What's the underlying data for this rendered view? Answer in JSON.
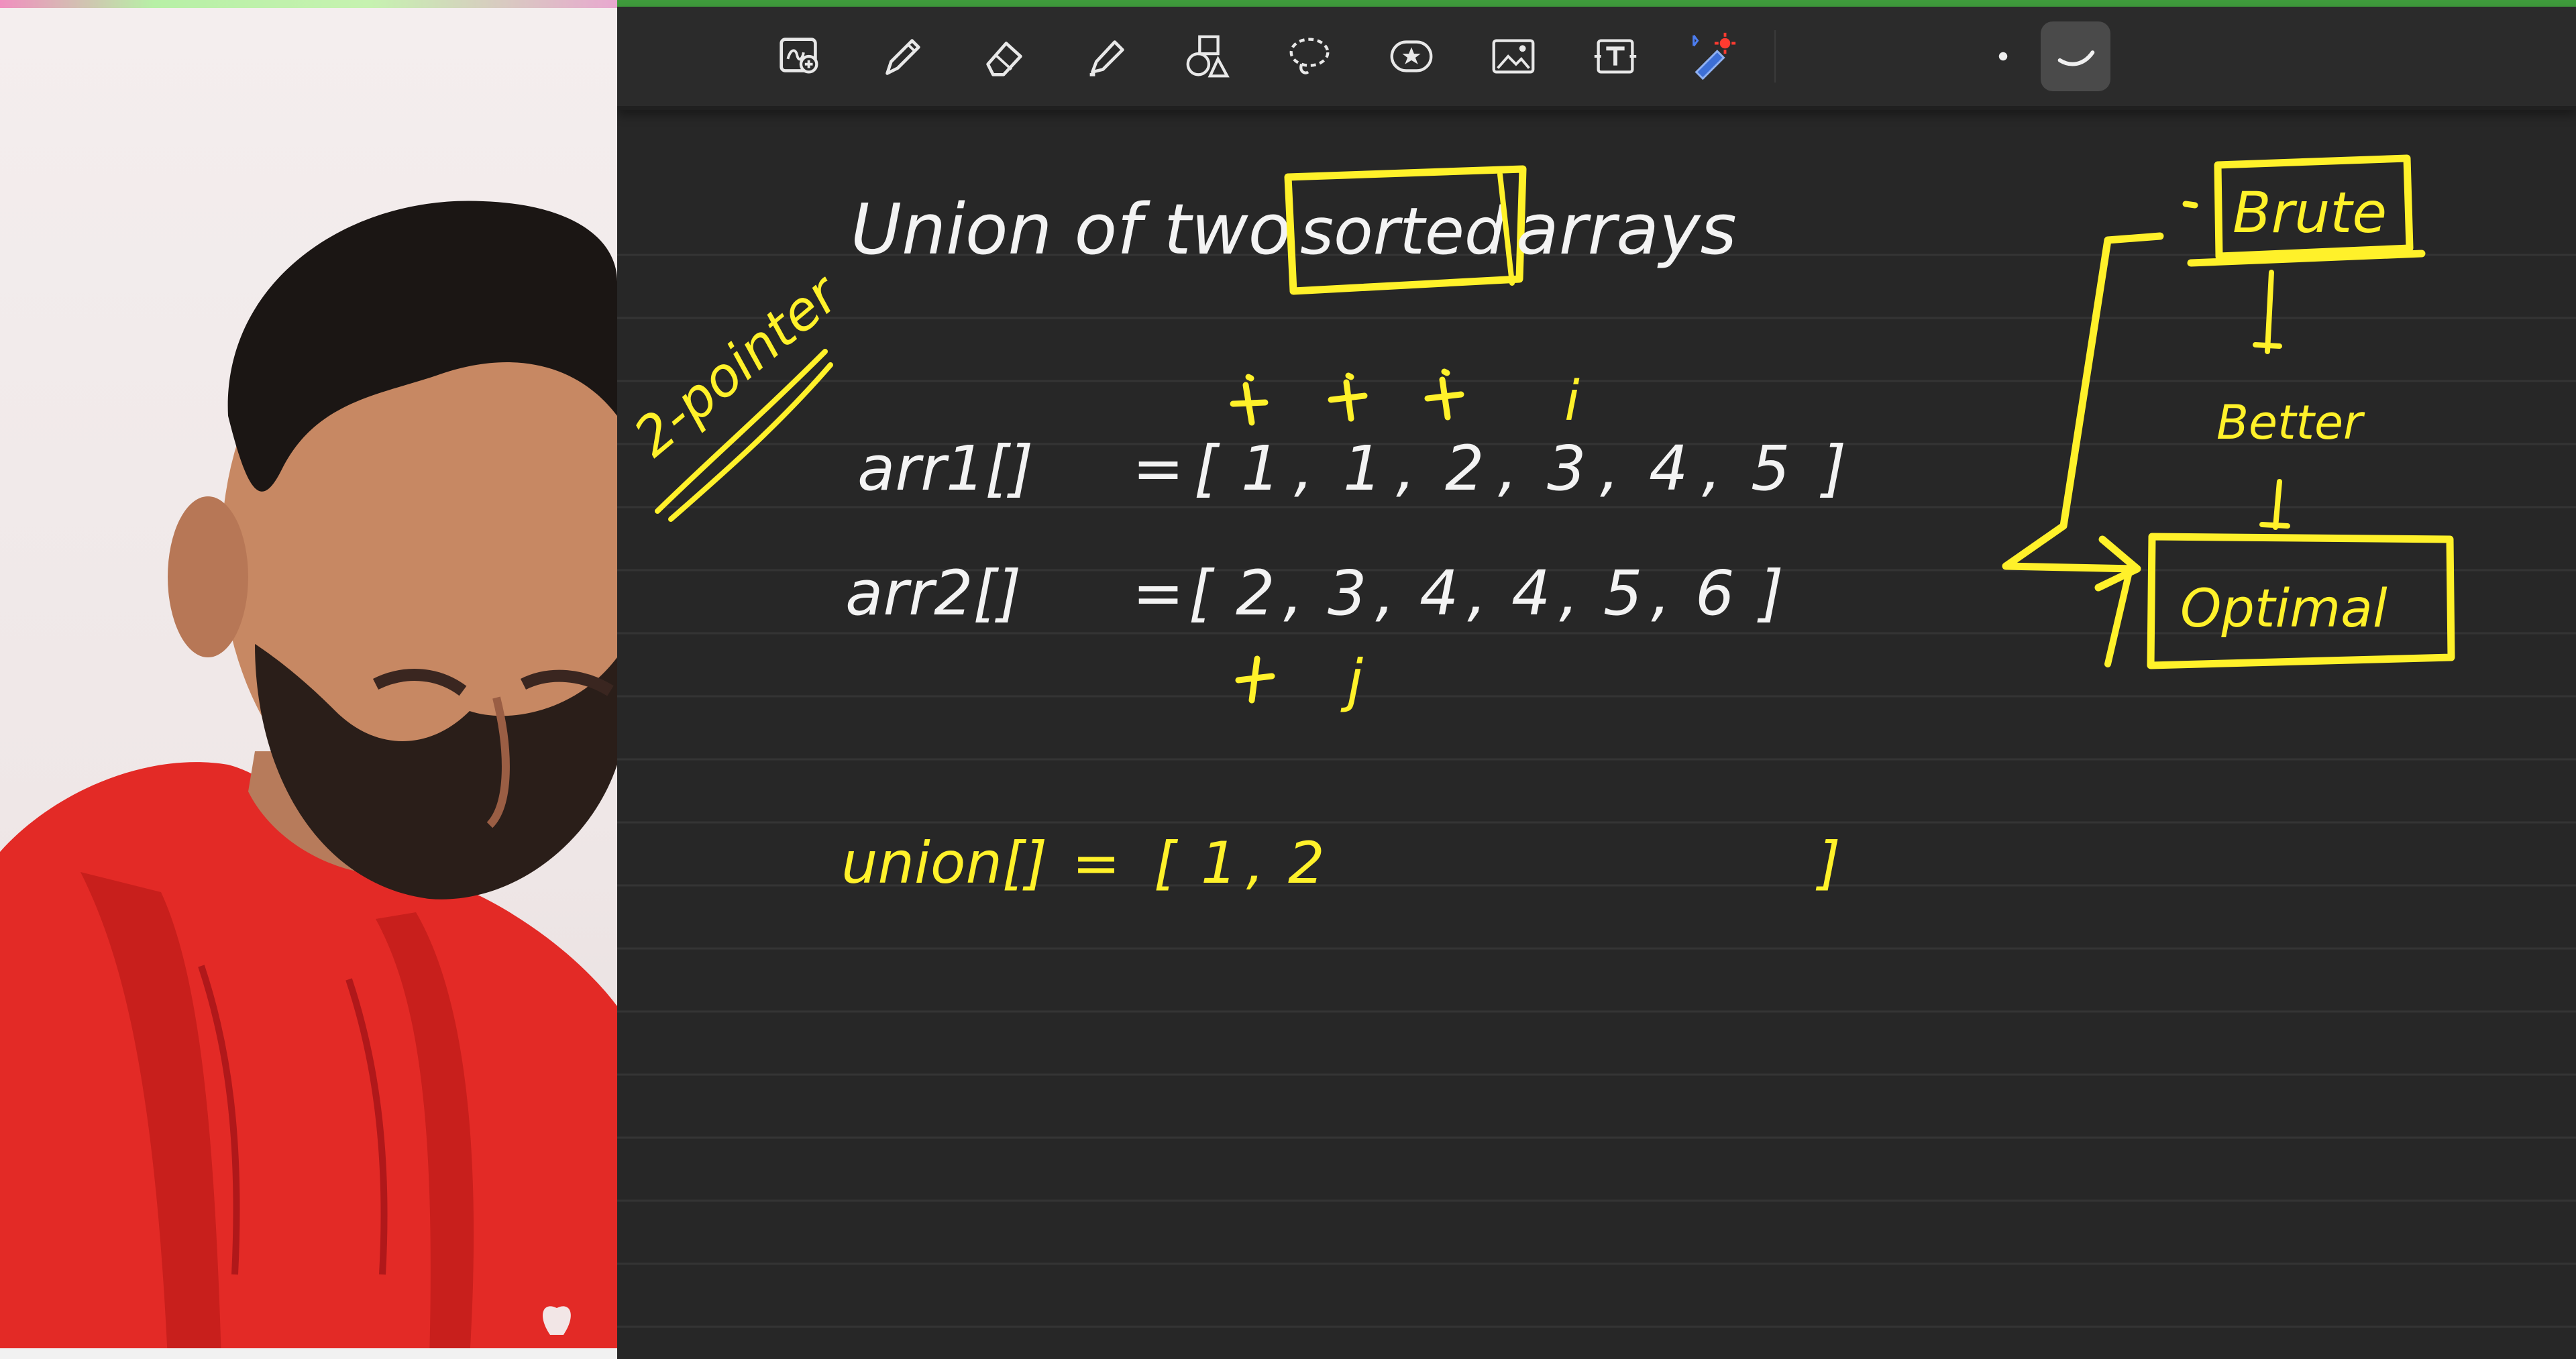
{
  "toolbar": {
    "tools": [
      {
        "name": "zoom-box-tool-icon",
        "active": false
      },
      {
        "name": "pen-tool-icon",
        "active": false
      },
      {
        "name": "eraser-tool-icon",
        "active": false
      },
      {
        "name": "highlighter-tool-icon",
        "active": false
      },
      {
        "name": "shapes-tool-icon",
        "active": false
      },
      {
        "name": "lasso-tool-icon",
        "active": false
      },
      {
        "name": "sticker-tool-icon",
        "active": false
      },
      {
        "name": "image-tool-icon",
        "active": false
      },
      {
        "name": "text-tool-icon",
        "active": false
      },
      {
        "name": "laser-pointer-tool-icon",
        "active": false
      },
      {
        "name": "stroke-size-dot-icon",
        "active": false
      },
      {
        "name": "curve-stroke-icon",
        "active": true
      }
    ]
  },
  "board": {
    "heading": {
      "before": "Union of two",
      "boxed": "sorted",
      "after": "arrays"
    },
    "side_note": "2-pointer",
    "arr1": {
      "label": "arr1[]",
      "eq": "=",
      "values": [
        "1",
        "1",
        "2",
        "3",
        "4",
        "5"
      ]
    },
    "arr2": {
      "label": "arr2[]",
      "eq": "=",
      "values": [
        "2",
        "3",
        "4",
        "4",
        "5",
        "6"
      ]
    },
    "pointer_i": "i",
    "pointer_j": "j",
    "union": {
      "label": "union[]",
      "eq": "=",
      "values": [
        "1",
        "2"
      ]
    },
    "approaches": {
      "brute": "Brute",
      "better": "Better",
      "optimal": "Optimal"
    }
  },
  "colors": {
    "board_bg": "#272727",
    "ink_white": "#f3f3f3",
    "ink_yellow": "#fff12a",
    "toolbar_bg": "#2b2b2b"
  }
}
